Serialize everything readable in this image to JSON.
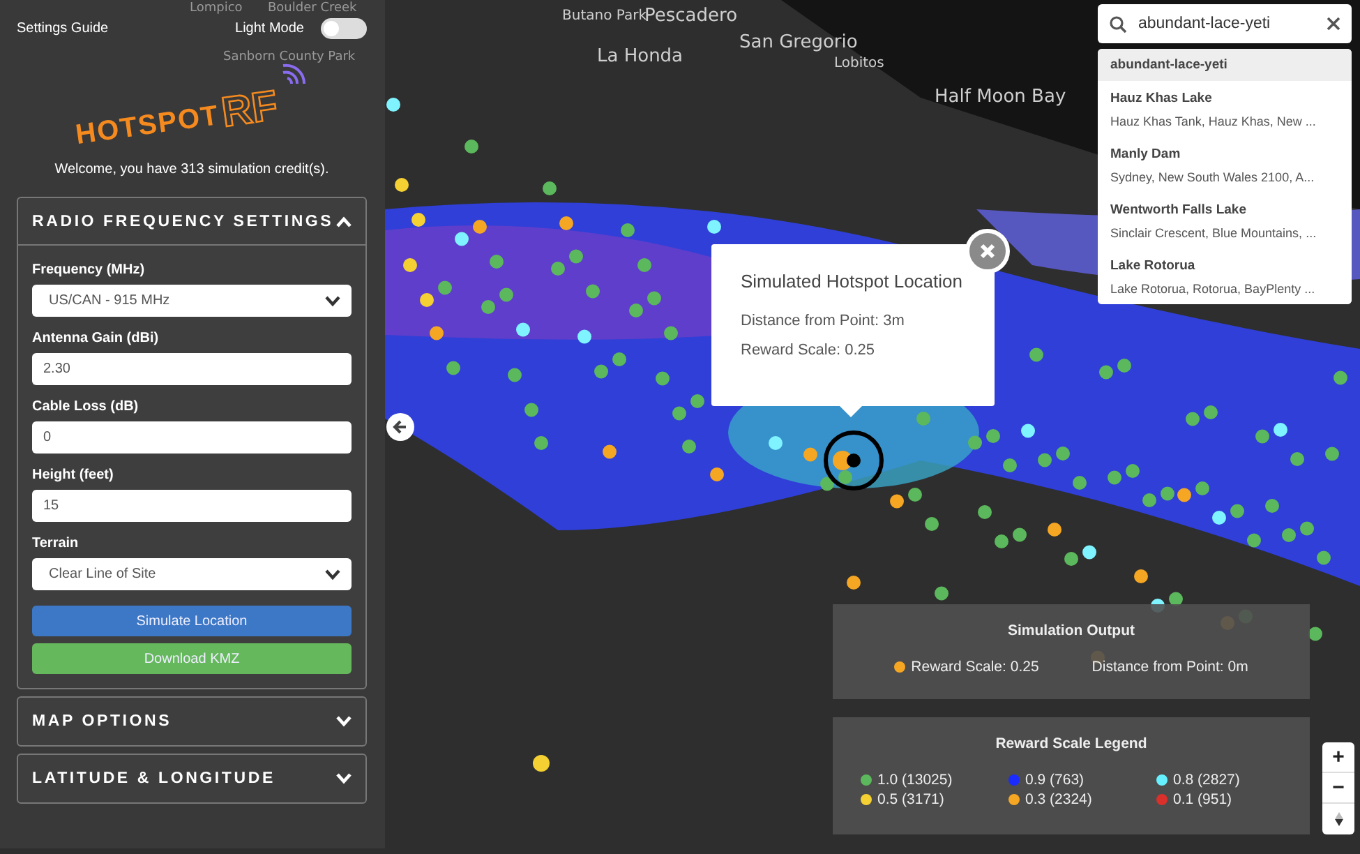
{
  "top_bar": {
    "guide_link": "Settings Guide",
    "light_mode": {
      "label": "Light Mode",
      "on": false
    }
  },
  "logo": {
    "main": "HOTSPOT",
    "accent": "RF"
  },
  "welcome": "Welcome, you have 313 simulation credit(s).",
  "sections": [
    {
      "title": "RADIO FREQUENCY SETTINGS",
      "expanded": true,
      "fields": [
        {
          "label": "Frequency (MHz)",
          "kind": "select",
          "value": "US/CAN - 915 MHz"
        },
        {
          "label": "Antenna Gain (dBi)",
          "kind": "input",
          "value": "2.30"
        },
        {
          "label": "Cable Loss (dB)",
          "kind": "input",
          "value": "0"
        },
        {
          "label": "Height (feet)",
          "kind": "input",
          "value": "15"
        },
        {
          "label": "Terrain",
          "kind": "select",
          "value": "Clear Line of Site"
        }
      ],
      "buttons": [
        {
          "label": "Simulate Location",
          "kind": "primary"
        },
        {
          "label": "Download KMZ",
          "kind": "success"
        }
      ]
    },
    {
      "title": "MAP OPTIONS",
      "expanded": false
    },
    {
      "title": "LATITUDE & LONGITUDE",
      "expanded": false
    }
  ],
  "map": {
    "labels": [
      {
        "text": "Lompico",
        "kind": "faint"
      },
      {
        "text": "Boulder Creek",
        "kind": "faint"
      },
      {
        "text": "Sanborn County Park",
        "kind": "faint"
      },
      {
        "text": "Butano Park",
        "kind": "small"
      },
      {
        "text": "Pescadero",
        "kind": "town"
      },
      {
        "text": "La Honda",
        "kind": "town"
      },
      {
        "text": "San Gregorio",
        "kind": "town"
      },
      {
        "text": "Lobitos",
        "kind": "small"
      },
      {
        "text": "Half Moon Bay",
        "kind": "town"
      }
    ]
  },
  "search": {
    "value": "abundant-lace-yeti",
    "results": [
      {
        "title": "abundant-lace-yeti",
        "selected": true
      },
      {
        "title": "Hauz Khas Lake",
        "subtitle": "Hauz Khas Tank, Hauz Khas, New ...",
        "selected": false
      },
      {
        "title": "Manly Dam",
        "subtitle": "Sydney, New South Wales 2100, A...",
        "selected": false
      },
      {
        "title": "Wentworth Falls Lake",
        "subtitle": "Sinclair Crescent, Blue Mountains, ...",
        "selected": false
      },
      {
        "title": "Lake Rotorua",
        "subtitle": "Lake Rotorua, Rotorua, BayPlenty ...",
        "selected": false
      }
    ]
  },
  "popup": {
    "title": "Simulated Hotspot Location",
    "lines": [
      "Distance from Point: 3m",
      "Reward Scale: 0.25"
    ]
  },
  "output": {
    "title": "Simulation Output",
    "reward": {
      "text": "Reward Scale: 0.25",
      "color": "#f5a623"
    },
    "distance": "Distance from Point: 0m"
  },
  "legend": {
    "title": "Reward Scale Legend",
    "items": [
      {
        "text": "1.0 (13025)",
        "color": "#5cb85c"
      },
      {
        "text": "0.9 (763)",
        "color": "#1a2bff"
      },
      {
        "text": "0.8 (2827)",
        "color": "#66f0ff"
      },
      {
        "text": "0.5 (3171)",
        "color": "#f5d033"
      },
      {
        "text": "0.3 (2324)",
        "color": "#f5a623"
      },
      {
        "text": "0.1 (951)",
        "color": "#d9302c"
      }
    ]
  },
  "zoom": {
    "in": "+",
    "out": "−"
  }
}
